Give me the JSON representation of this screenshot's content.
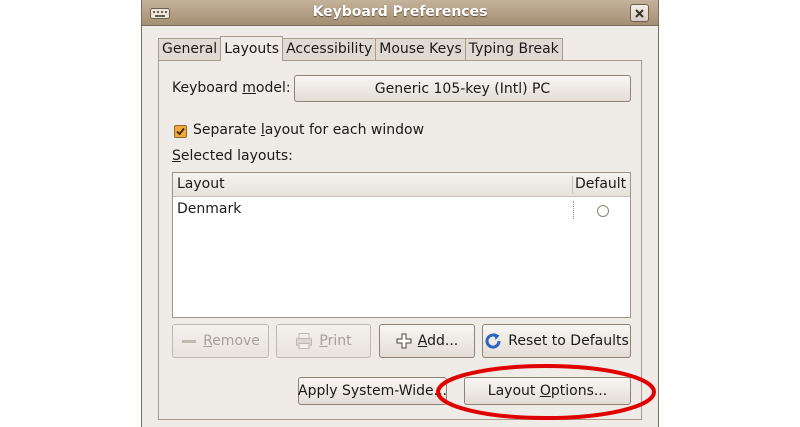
{
  "window": {
    "title": "Keyboard Preferences"
  },
  "tabs": [
    {
      "label": "General",
      "active": false
    },
    {
      "label": "Layouts",
      "active": true
    },
    {
      "label": "Accessibility",
      "active": false
    },
    {
      "label": "Mouse Keys",
      "active": false
    },
    {
      "label": "Typing Break",
      "active": false
    }
  ],
  "keyboard_model": {
    "label_pre": "Keyboard ",
    "label_mnemonic": "m",
    "label_post": "odel:",
    "value": "Generic 105-key (Intl) PC"
  },
  "separate_layout": {
    "label_pre": "Separate ",
    "label_mnemonic": "l",
    "label_post": "ayout for each window",
    "checked": true
  },
  "selected_layouts": {
    "label_mnemonic": "S",
    "label_post": "elected layouts:",
    "columns": [
      "Layout",
      "Default"
    ],
    "rows": [
      {
        "name": "Denmark",
        "default": false
      }
    ]
  },
  "buttons": {
    "remove": {
      "mnemonic": "R",
      "rest": "emove",
      "enabled": false
    },
    "print": {
      "mnemonic": "P",
      "rest": "rint",
      "enabled": false
    },
    "add": {
      "mnemonic": "A",
      "rest": "dd...",
      "enabled": true
    },
    "reset": {
      "mnemonic": "",
      "label": "Reset to Defaults",
      "enabled": true
    },
    "apply_system_wide": {
      "label": "Apply System-Wide...",
      "enabled": true
    },
    "layout_options": {
      "pre": "Layout ",
      "mnemonic": "O",
      "post": "ptions...",
      "enabled": true
    }
  },
  "colors": {
    "titlebar": "#a48f73",
    "window_bg": "#efebe7",
    "checkbox": "#f2a93b",
    "annotation_circle": "#e00000",
    "reset_icon": "#2a66c4"
  }
}
